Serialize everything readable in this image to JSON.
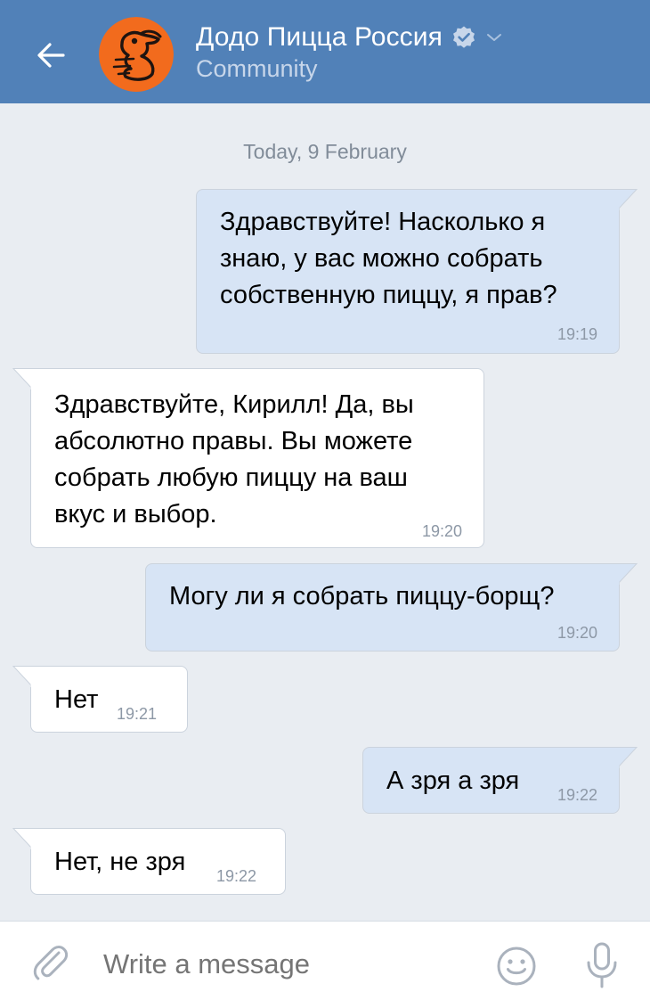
{
  "header": {
    "title": "Додо Пицца Россия",
    "subtitle": "Community"
  },
  "chat": {
    "date_separator": "Today, 9 February",
    "messages": [
      {
        "direction": "outgoing",
        "lines": [
          "Здравствуйте! Насколько я",
          "знаю, у вас можно собрать",
          "собственную пиццу, я прав?"
        ],
        "time": "19:19"
      },
      {
        "direction": "incoming",
        "lines": [
          "Здравствуйте, Кирилл! Да, вы",
          "абсолютно правы. Вы можете",
          "собрать любую пиццу на ваш",
          "вкус и выбор."
        ],
        "time": "19:20"
      },
      {
        "direction": "outgoing",
        "lines": [
          "Могу ли я собрать пиццу-борщ?"
        ],
        "time": "19:20"
      },
      {
        "direction": "incoming",
        "lines": [
          "Нет"
        ],
        "time": "19:21"
      },
      {
        "direction": "outgoing",
        "lines": [
          "А зря а зря"
        ],
        "time": "19:22"
      },
      {
        "direction": "incoming",
        "lines": [
          "Нет, не зря"
        ],
        "time": "19:22"
      }
    ]
  },
  "input": {
    "placeholder": "Write a message"
  },
  "colors": {
    "header_bg": "#5181b8",
    "chat_bg": "#e9edf2",
    "outgoing_bubble": "#d7e4f5",
    "incoming_bubble": "#ffffff",
    "avatar_orange": "#f26b1d"
  },
  "icons": [
    "back-arrow-icon",
    "verified-icon",
    "chevron-down-icon",
    "attach-icon",
    "emoji-icon",
    "microphone-icon"
  ]
}
